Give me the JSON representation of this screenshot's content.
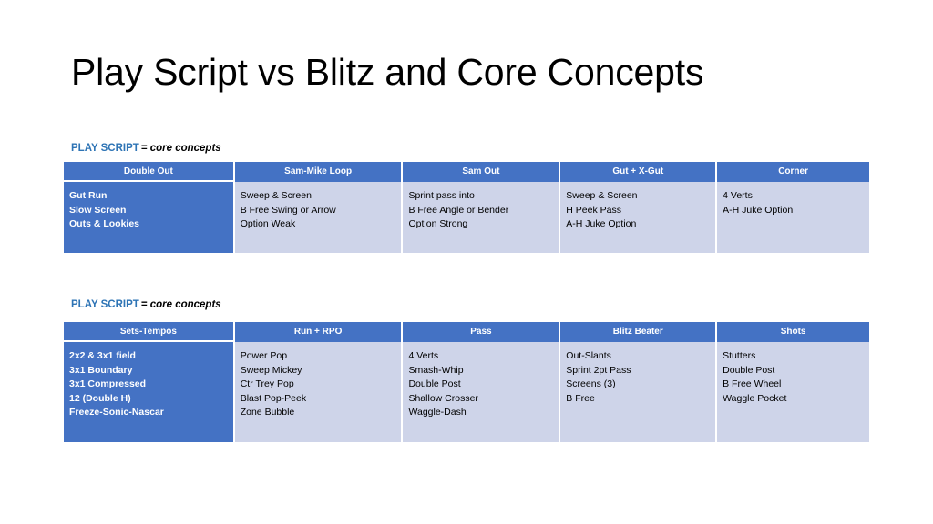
{
  "slide": {
    "title": "Play Script vs Blitz and Core Concepts",
    "accent_blue": "#4472C4",
    "label_blue": "#2E74B5",
    "cell_fill": "#CED4E9",
    "background": "#FFFFFF"
  },
  "label": {
    "play_script": "PLAY SCRIPT",
    "equals": "=",
    "core_concepts": "core concepts"
  },
  "tables": [
    {
      "id": "play-script-core-concepts-1",
      "headers": [
        "Double Out",
        "Sam-Mike Loop",
        "Sam Out",
        "Gut + X-Gut",
        "Corner"
      ],
      "columns": [
        {
          "header": "Double Out",
          "highlight": true,
          "items": [
            "Gut Run",
            "Slow Screen",
            "Outs & Lookies"
          ]
        },
        {
          "header": "Sam-Mike Loop",
          "highlight": false,
          "items": [
            "Sweep & Screen",
            "B Free Swing or Arrow",
            "Option Weak"
          ]
        },
        {
          "header": "Sam Out",
          "highlight": false,
          "items": [
            "Sprint pass into",
            "B Free Angle or Bender",
            "Option Strong"
          ]
        },
        {
          "header": "Gut + X-Gut",
          "highlight": false,
          "items": [
            "Sweep & Screen",
            "H Peek Pass",
            "A-H Juke Option"
          ]
        },
        {
          "header": "Corner",
          "highlight": false,
          "items": [
            "4 Verts",
            "A-H Juke Option"
          ]
        }
      ]
    },
    {
      "id": "play-script-core-concepts-2",
      "headers": [
        "Sets-Tempos",
        "Run + RPO",
        "Pass",
        "Blitz Beater",
        "Shots"
      ],
      "columns": [
        {
          "header": "Sets-Tempos",
          "highlight": true,
          "items": [
            "2x2 & 3x1 field",
            "3x1 Boundary",
            "3x1 Compressed",
            "12 (Double H)",
            "Freeze-Sonic-Nascar"
          ]
        },
        {
          "header": "Run + RPO",
          "highlight": false,
          "items": [
            "Power Pop",
            "Sweep Mickey",
            "Ctr Trey Pop",
            "Blast Pop-Peek",
            "Zone Bubble"
          ]
        },
        {
          "header": "Pass",
          "highlight": false,
          "items": [
            "4 Verts",
            "Smash-Whip",
            "Double Post",
            "Shallow Crosser",
            "Waggle-Dash"
          ]
        },
        {
          "header": "Blitz Beater",
          "highlight": false,
          "items": [
            "Out-Slants",
            "Sprint 2pt Pass",
            "Screens (3)",
            "B Free"
          ]
        },
        {
          "header": "Shots",
          "highlight": false,
          "items": [
            "Stutters",
            "Double Post",
            "B Free Wheel",
            "Waggle Pocket"
          ]
        }
      ]
    }
  ]
}
